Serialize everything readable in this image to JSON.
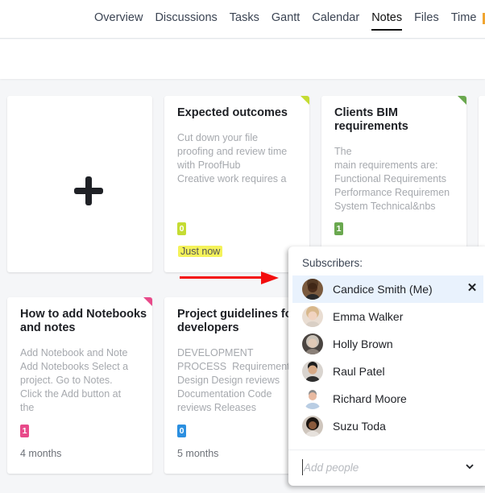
{
  "nav": {
    "tabs": [
      {
        "label": "Overview",
        "active": false
      },
      {
        "label": "Discussions",
        "active": false
      },
      {
        "label": "Tasks",
        "active": false
      },
      {
        "label": "Gantt",
        "active": false
      },
      {
        "label": "Calendar",
        "active": false
      },
      {
        "label": "Notes",
        "active": true
      },
      {
        "label": "Files",
        "active": false
      },
      {
        "label": "Time",
        "active": false
      }
    ]
  },
  "add_note": {
    "icon": "plus-icon"
  },
  "notes": [
    {
      "title": "Expected outcomes",
      "body": "Cut down your file\nproofing and review time\nwith ProofHub\nCreative work requires a",
      "count": "0",
      "time": "Just now",
      "color": "#c5dc33"
    },
    {
      "title": "Clients BIM requirements",
      "body": "The\nmain requirements are:\nFunctional Requirements\nPerformance Requiremen\nSystem Technical&nbs",
      "count": "1",
      "time": "",
      "color": "#6aa84f"
    },
    {
      "title": "How to add Notebooks and notes",
      "body": "Add Notebook and Note\nAdd Notebooks Select a\nproject. Go to Notes.\nClick the Add button at\nthe",
      "count": "1",
      "time": "4 months",
      "color": "#e84a8a"
    },
    {
      "title": "Project guidelines for developers",
      "body": "DEVELOPMENT\nPROCESS  Requirements\nDesign Design reviews\nDocumentation Code\nreviews Releases",
      "count": "0",
      "time": "5 months",
      "color": "#2b8fe0"
    }
  ],
  "subscribers_popup": {
    "title": "Subscribers:",
    "subscribers": [
      {
        "name": "Candice Smith (Me)",
        "is_me": true
      },
      {
        "name": "Emma Walker",
        "is_me": false
      },
      {
        "name": "Holly Brown",
        "is_me": false
      },
      {
        "name": "Raul Patel",
        "is_me": false
      },
      {
        "name": "Richard Moore",
        "is_me": false
      },
      {
        "name": "Suzu Toda",
        "is_me": false
      }
    ],
    "remove_icon": "✕",
    "add_placeholder": "Add people",
    "add_value": ""
  },
  "colors": {
    "highlight": "#f4f25a",
    "arrow": "#f30d0d",
    "selected_row": "#e9f2fd"
  }
}
